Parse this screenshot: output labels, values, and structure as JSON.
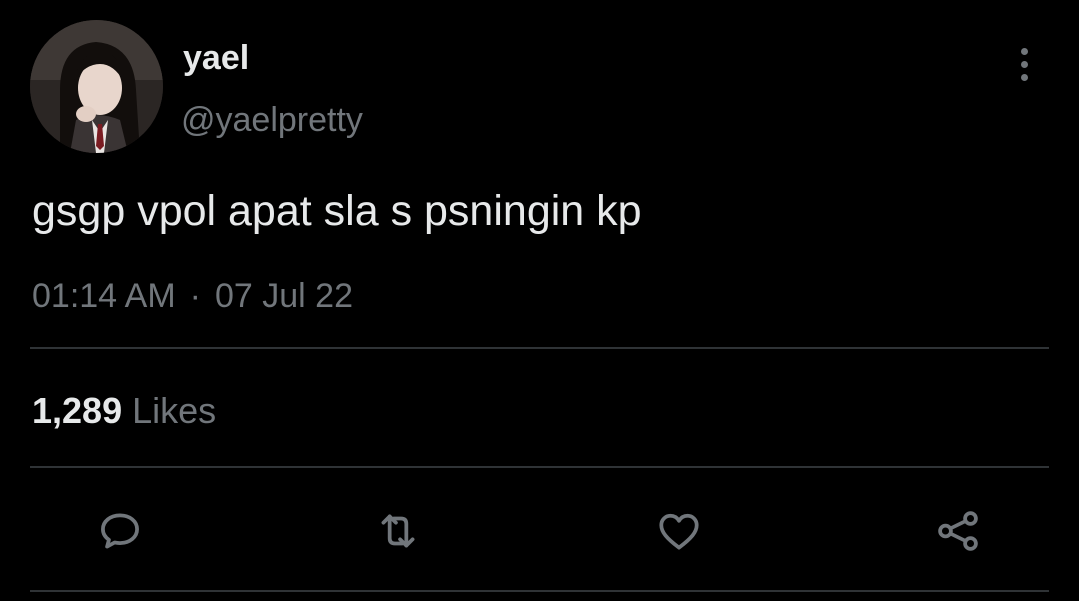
{
  "tweet": {
    "author": {
      "display_name": "yael",
      "handle": "@yaelpretty"
    },
    "text": "gsgp vpol apat sla s psningin kp",
    "time": "01:14 AM",
    "separator": "·",
    "date": "07 Jul 22",
    "likes": {
      "count": "1,289",
      "label": "Likes"
    }
  },
  "actions": {
    "reply_icon": "speech-bubble-icon",
    "retweet_icon": "retweet-icon",
    "like_icon": "heart-icon",
    "share_icon": "share-icon"
  },
  "colors": {
    "background": "#000000",
    "primary_text": "#e7e9ea",
    "secondary_text": "#71767b",
    "divider": "#2f3336"
  }
}
